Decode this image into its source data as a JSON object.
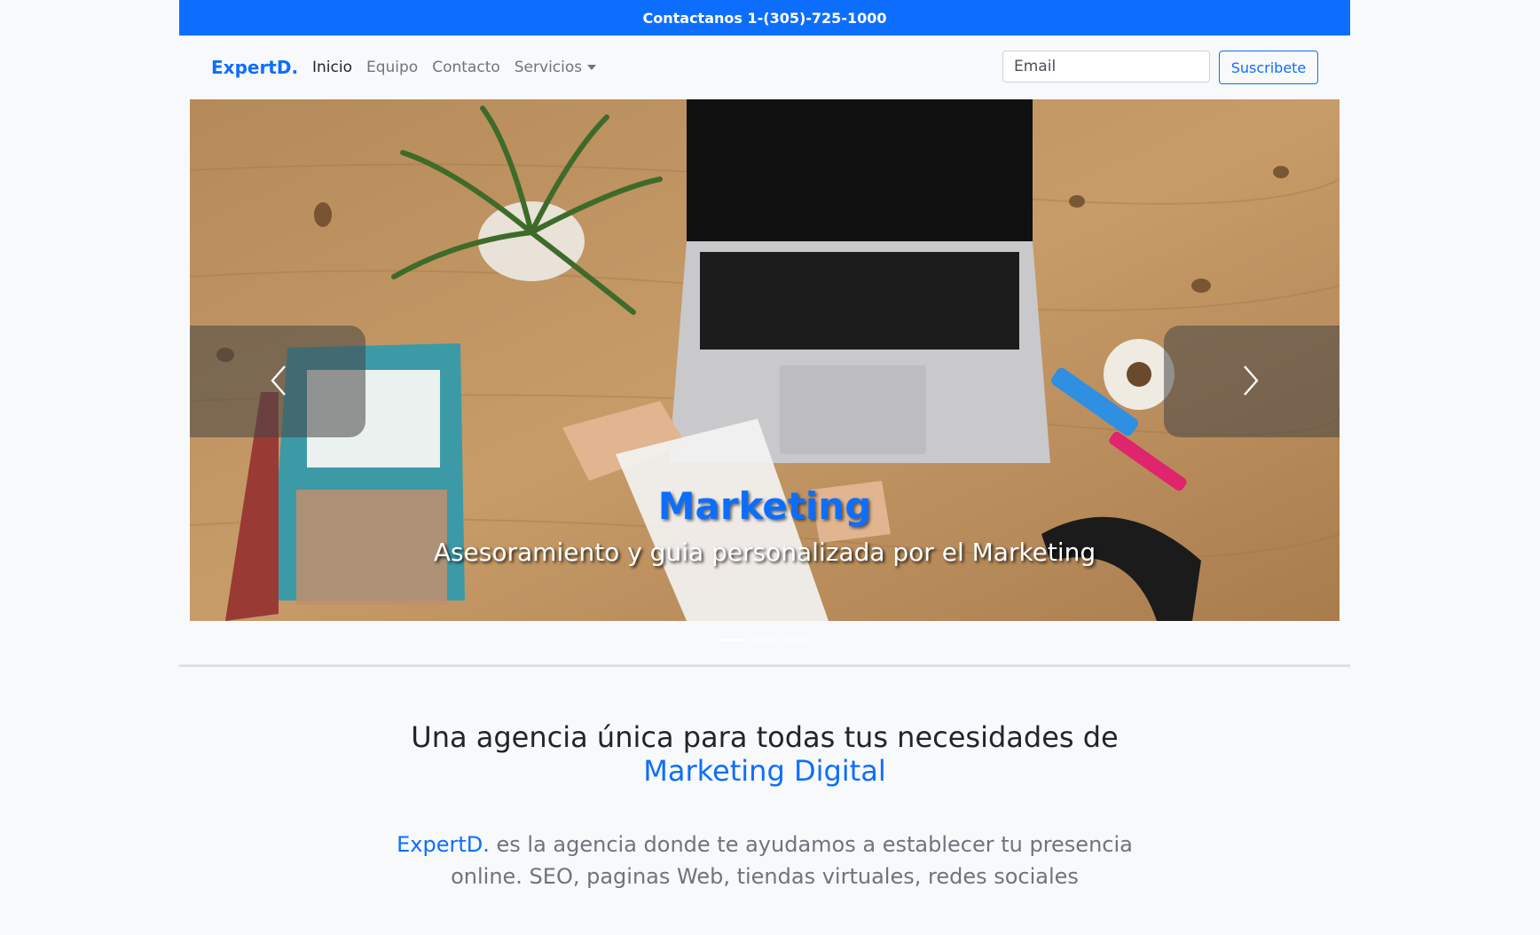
{
  "topbar": {
    "text": "Contactanos 1-(305)-725-1000"
  },
  "nav": {
    "brand": "ExpertD.",
    "links": [
      "Inicio",
      "Equipo",
      "Contacto",
      "Servicios"
    ],
    "email_placeholder": "Email",
    "subscribe_label": "Suscribete"
  },
  "carousel": {
    "title": "Marketing",
    "text": "Asesoramiento y guia personalizada por el Marketing",
    "indicator_count": 3,
    "active_index": 0
  },
  "hero": {
    "headline_line1": "Una agencia única para todas tus necesidades de",
    "headline_accent": "Marketing Digital"
  },
  "intro": {
    "brand": "ExpertD.",
    "text_line1": " es la agencia donde te ayudamos a establecer tu presencia",
    "text_line2": "online. SEO, paginas Web, tiendas virtuales, redes sociales"
  },
  "colors": {
    "accent": "#0d6efd",
    "topbar_bg": "#0d6efd",
    "page_bg": "#f8f9fa"
  }
}
